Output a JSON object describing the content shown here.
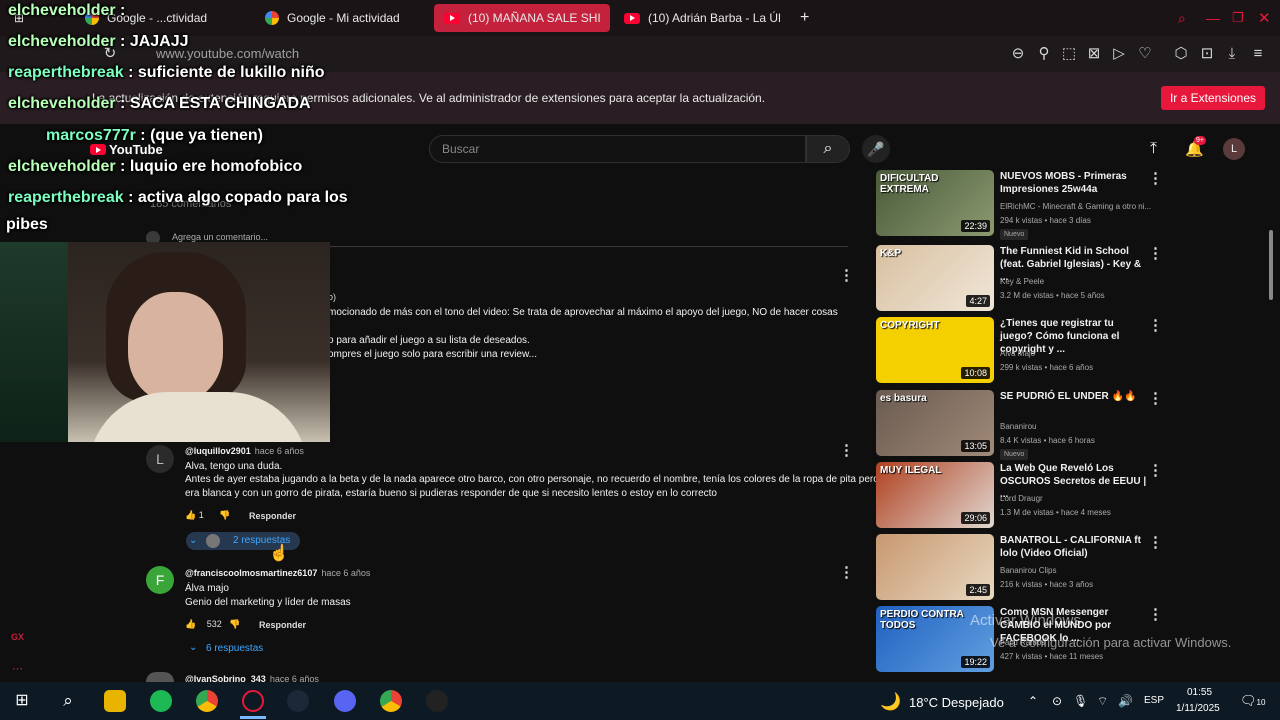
{
  "browser": {
    "tabs": [
      {
        "label": "Google - ...ctividad"
      },
      {
        "label": "Google - Mi actividad"
      },
      {
        "label": "(10) MAÑANA SALE SHIP"
      },
      {
        "label": "(10) Adrián Barba - La Últ"
      }
    ],
    "url": "www.youtube.com/watch",
    "notice": "La actualización de extensión requiere permisos adicionales. Ve al administrador de extensiones para aceptar la actualización.",
    "notice_button": "Ir a Extensiones"
  },
  "youtube": {
    "logo": "YouTube",
    "search_placeholder": "Buscar",
    "notif_count": "9+",
    "account_initial": "L",
    "comments_count_label": "185 comentarios",
    "add_comment_placeholder": "Agrega un comentario...",
    "pinned_comment": {
      "user_fragment": "o)",
      "lines": [
        "mocionado de más con el tono del video: Se trata de aprovechar al máximo el apoyo del juego, NO de hacer cosas",
        "o para añadir el juego a su lista de deseados.",
        "ompres el juego solo para escribir una review..."
      ]
    },
    "comments": [
      {
        "avatar": "L",
        "user": "@luquillov2901",
        "ago": "hace 6 años",
        "lines": [
          "Alva, tengo una duda.",
          "Antes de ayer estaba jugando a la beta y de la nada aparece otro barco, con otro personaje, no recuerdo el nombre, tenía los colores de la ropa de pita pero",
          "era blanca y con un gorro de pirata, estaría bueno si pudieras responder de que si necesito lentes o estoy en lo correcto"
        ],
        "likes": "1",
        "reply_label": "Responder",
        "replies_label": "2 respuestas"
      },
      {
        "avatar": "F",
        "user": "@franciscoolmosmartinez6107",
        "ago": "hace 6 años",
        "lines": [
          "Álva majo",
          "Genio del marketing y líder de masas"
        ],
        "likes": "532",
        "reply_label": "Responder",
        "replies_label": "6 respuestas"
      },
      {
        "user": "@IvanSobrino_343",
        "ago": "hace 6 años"
      }
    ],
    "sidebar": [
      {
        "title": "NUEVOS MOBS - Primeras Impresiones 25w44a",
        "channel": "ElRichMC - Minecraft & Gaming a otro ni...",
        "meta": "294 k vistas • hace 3 días",
        "badge": "Nuevo",
        "duration": "22:39",
        "thumb_text": "DIFICULTAD EXTREMA",
        "colors": [
          "#4a5a3a",
          "#8b9a70"
        ]
      },
      {
        "title": "The Funniest Kid in School (feat. Gabriel Iglesias) - Key & ...",
        "channel": "Key & Peele",
        "meta": "3.2 M de vistas • hace 5 años",
        "badge": "",
        "duration": "4:27",
        "thumb_text": "K&P",
        "colors": [
          "#d8c0a0",
          "#f0e6d8"
        ]
      },
      {
        "title": "¿Tienes que registrar tu juego? Cómo funciona el copyright y ...",
        "channel": "Alva Majo",
        "meta": "299 k vistas • hace 6 años",
        "badge": "",
        "duration": "10:08",
        "thumb_text": "COPYRIGHT",
        "colors": [
          "#f5d000",
          "#f5d000"
        ]
      },
      {
        "title": "SE PUDRIÓ EL UNDER 🔥🔥",
        "channel": "Bananirou",
        "meta": "8.4 K vistas • hace 6 horas",
        "badge": "Nuevo",
        "duration": "13:05",
        "thumb_text": "es basura",
        "colors": [
          "#6a5a50",
          "#a08a78"
        ]
      },
      {
        "title": "La Web Que Reveló Los OSCUROS Secretos de EEUU | ...",
        "channel": "Lord Draugr",
        "meta": "1.3 M de vistas • hace 4 meses",
        "badge": "",
        "duration": "29:06",
        "thumb_text": "MUY ILEGAL",
        "colors": [
          "#b04020",
          "#e0d8d0"
        ]
      },
      {
        "title": "BANATROLL - CALIFORNIA ft lolo (Video Oficial)",
        "channel": "Bananirou Clips",
        "meta": "216 k vistas • hace 3 años",
        "badge": "",
        "duration": "2:45",
        "thumb_text": "",
        "colors": [
          "#c89870",
          "#e8d8c0"
        ]
      },
      {
        "title": "Como MSN Messenger CAMBIO el MUNDO por FACEBOOK lo ...",
        "channel": "Facu Ramos",
        "meta": "427 k vistas • hace 11 meses",
        "badge": "",
        "duration": "19:22",
        "thumb_text": "PERDIO CONTRA TODOS",
        "colors": [
          "#2060c0",
          "#60a0e0"
        ]
      }
    ]
  },
  "chat": [
    {
      "user": "elcheveholder",
      "text": ""
    },
    {
      "user": "elcheveholder",
      "text": "JAJAJJ"
    },
    {
      "user": "reaperthebreak",
      "text": "suficiente de lukillo niño"
    },
    {
      "user": "elcheveholder",
      "text": "SACA ESTA CHINGADA"
    },
    {
      "user": "marcos777r",
      "text": "(que ya tienen)"
    },
    {
      "user": "elcheveholder",
      "text": "luquio ere homofobico"
    },
    {
      "user": "reaperthebreak",
      "text": "activa algo copado para los"
    },
    {
      "user": "",
      "text": "pibes"
    }
  ],
  "watermark": {
    "line1": "Activar Windows",
    "line2": "Ve a Configuración para activar Windows."
  },
  "taskbar": {
    "weather": "18°C  Despejado",
    "lang": "ESP",
    "time": "01:55",
    "date": "1/11/2025",
    "notif": "10"
  },
  "colors": {
    "accent": "#e8183c",
    "link": "#3ea6ff",
    "taskbar": "#0d1a24"
  }
}
